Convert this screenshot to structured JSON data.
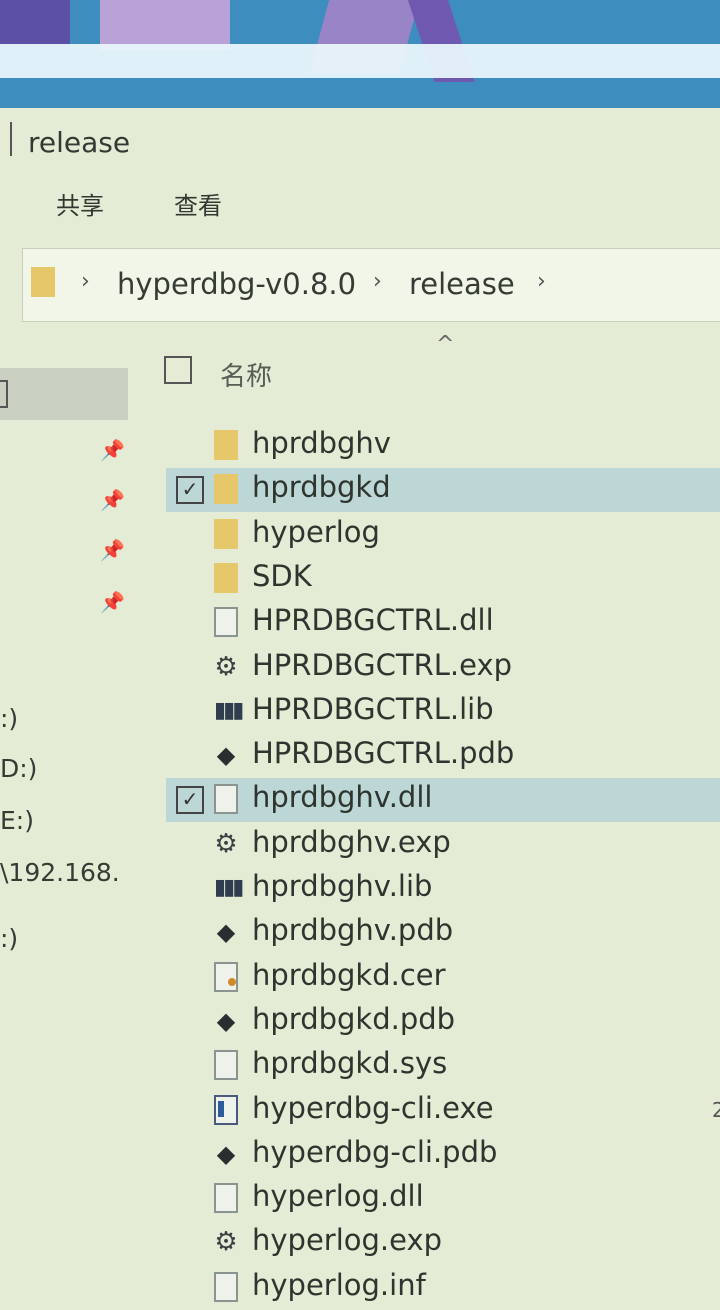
{
  "window": {
    "title": "release"
  },
  "ribbon": {
    "tabs": [
      "共享",
      "查看"
    ]
  },
  "address": {
    "crumbs": [
      "hyperdbg-v0.8.0",
      "release"
    ]
  },
  "header": {
    "name_col": "名称"
  },
  "nav": {
    "drives": [
      ":)",
      "D:)",
      "E:)",
      "\\192.168.",
      ":)"
    ]
  },
  "files": [
    {
      "name": "hprdbghv",
      "type": "folder",
      "checked": false
    },
    {
      "name": "hprdbgkd",
      "type": "folder",
      "checked": true
    },
    {
      "name": "hyperlog",
      "type": "folder",
      "checked": false
    },
    {
      "name": "SDK",
      "type": "folder",
      "checked": false
    },
    {
      "name": "HPRDBGCTRL.dll",
      "type": "dll",
      "checked": false
    },
    {
      "name": "HPRDBGCTRL.exp",
      "type": "exp",
      "checked": false
    },
    {
      "name": "HPRDBGCTRL.lib",
      "type": "lib",
      "checked": false
    },
    {
      "name": "HPRDBGCTRL.pdb",
      "type": "pdb",
      "checked": false
    },
    {
      "name": "hprdbghv.dll",
      "type": "dll",
      "checked": true
    },
    {
      "name": "hprdbghv.exp",
      "type": "exp",
      "checked": false
    },
    {
      "name": "hprdbghv.lib",
      "type": "lib",
      "checked": false
    },
    {
      "name": "hprdbghv.pdb",
      "type": "pdb",
      "checked": false
    },
    {
      "name": "hprdbgkd.cer",
      "type": "cer",
      "checked": false
    },
    {
      "name": "hprdbgkd.pdb",
      "type": "pdb",
      "checked": false
    },
    {
      "name": "hprdbgkd.sys",
      "type": "sys",
      "checked": false
    },
    {
      "name": "hyperdbg-cli.exe",
      "type": "exe",
      "checked": false
    },
    {
      "name": "hyperdbg-cli.pdb",
      "type": "pdb",
      "checked": false
    },
    {
      "name": "hyperlog.dll",
      "type": "dll",
      "checked": false
    },
    {
      "name": "hyperlog.exp",
      "type": "exp",
      "checked": false
    },
    {
      "name": "hyperlog.inf",
      "type": "sys",
      "checked": false
    }
  ],
  "colors": {
    "selected_row": "#bcd7d6",
    "folder": "#e6c86a",
    "background": "#e4ecd6"
  }
}
